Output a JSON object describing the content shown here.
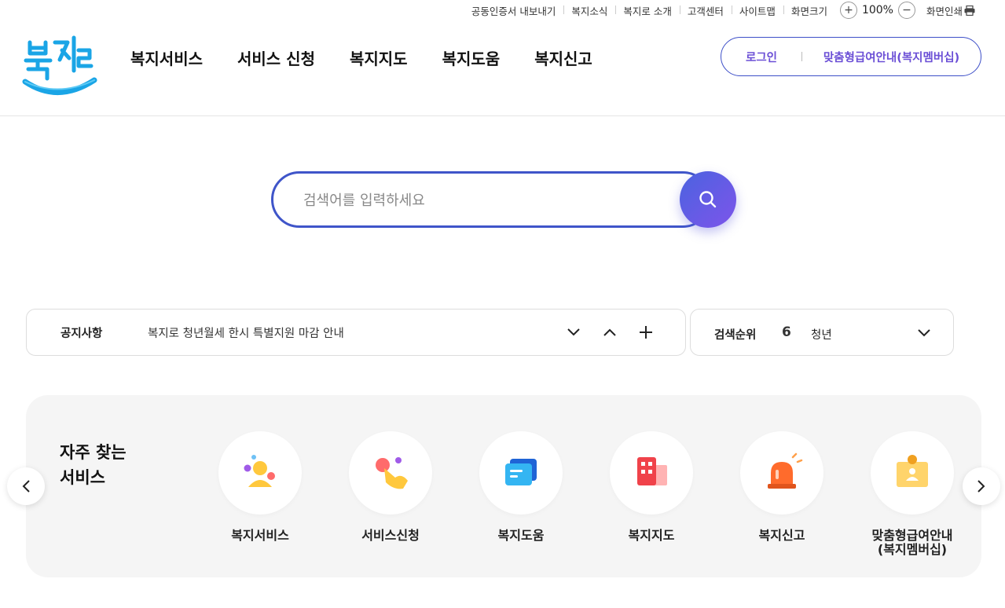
{
  "util": {
    "links": [
      "공동인증서 내보내기",
      "복지소식",
      "복지로 소개",
      "고객센터",
      "사이트맵"
    ],
    "zoom_label": "화면크기",
    "zoom_value": "100%",
    "print_label": "화면인쇄"
  },
  "header": {
    "logo_text": "복지로",
    "nav": [
      "복지서비스",
      "서비스 신청",
      "복지지도",
      "복지도움",
      "복지신고"
    ],
    "login_label": "로그인",
    "member_label": "맞춤형급여안내(복지멤버십)"
  },
  "search": {
    "placeholder": "검색어를 입력하세요"
  },
  "notice": {
    "label": "공지사항",
    "text": "복지로 청년월세 한시 특별지원 마감 안내"
  },
  "rank": {
    "label": "검색순위",
    "number": "6",
    "term": "청년"
  },
  "frequent": {
    "title": "자주 찾는\n서비스",
    "items": [
      {
        "label": "복지서비스",
        "icon": "person-icon"
      },
      {
        "label": "서비스신청",
        "icon": "hand-pointer-icon"
      },
      {
        "label": "복지도움",
        "icon": "chat-card-icon"
      },
      {
        "label": "복지지도",
        "icon": "map-building-icon"
      },
      {
        "label": "복지신고",
        "icon": "alarm-siren-icon"
      },
      {
        "label": "맞춤형급여안내\n(복지멤버십)",
        "icon": "id-badge-icon"
      }
    ]
  },
  "colors": {
    "primary": "#3f55c9",
    "accent_purple": "#6b4fd6",
    "logo_blue": "#1aa5e6"
  }
}
